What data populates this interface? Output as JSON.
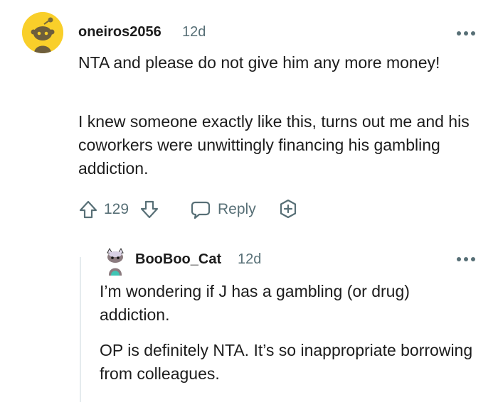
{
  "comments": [
    {
      "username": "oneiros2056",
      "age": "12d",
      "paragraphs": [
        "NTA and please do not give him any more money!",
        "I knew someone exactly like this, turns out me and his coworkers were unwittingly financing his gambling addiction."
      ],
      "score": "129",
      "reply_label": "Reply",
      "avatar_color": "#f9cf2a"
    },
    {
      "username": "BooBoo_Cat",
      "age": "12d",
      "paragraphs": [
        "I’m wondering if J has a gambling (or drug) addiction.",
        "OP is definitely NTA. It’s so inappropriate borrowing from colleagues."
      ]
    }
  ],
  "icons": {
    "more": "more-horizontal-icon",
    "upvote": "upvote-arrow-icon",
    "downvote": "downvote-arrow-icon",
    "reply": "speech-bubble-icon",
    "award": "add-award-icon"
  },
  "colors": {
    "text": "#1c1c1c",
    "meta": "#576f76",
    "thread_line": "#e5ebee"
  }
}
